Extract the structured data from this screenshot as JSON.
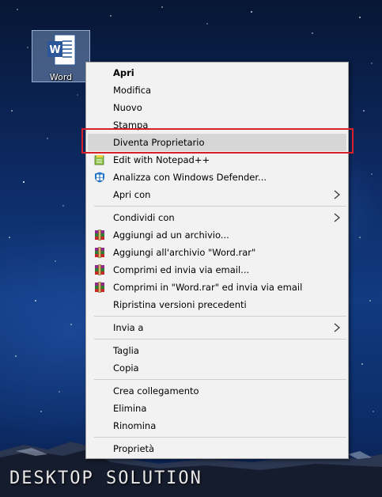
{
  "desktop_icon": {
    "label": "Word",
    "icon": "word-document-icon"
  },
  "context_menu": {
    "items": [
      {
        "label": "Apri",
        "bold": true
      },
      {
        "label": "Modifica"
      },
      {
        "label": "Nuovo"
      },
      {
        "label": "Stampa"
      },
      {
        "label": "Diventa Proprietario",
        "highlighted": true
      },
      {
        "label": "Edit with Notepad++",
        "icon": "notepad-plus-icon"
      },
      {
        "label": "Analizza con Windows Defender...",
        "icon": "windows-defender-icon"
      },
      {
        "label": "Apri con",
        "submenu": true
      },
      {
        "label": "Condividi con",
        "submenu": true
      },
      {
        "label": "Aggiungi ad un archivio...",
        "icon": "winrar-icon"
      },
      {
        "label": "Aggiungi all'archivio \"Word.rar\"",
        "icon": "winrar-icon"
      },
      {
        "label": "Comprimi ed invia via email...",
        "icon": "winrar-icon"
      },
      {
        "label": "Comprimi in \"Word.rar\" ed invia via email",
        "icon": "winrar-icon"
      },
      {
        "label": "Ripristina versioni precedenti"
      },
      {
        "label": "Invia a",
        "submenu": true
      },
      {
        "label": "Taglia"
      },
      {
        "label": "Copia"
      },
      {
        "label": "Crea collegamento"
      },
      {
        "label": "Elimina"
      },
      {
        "label": "Rinomina"
      },
      {
        "label": "Proprietà"
      }
    ]
  },
  "colors": {
    "highlight_border": "#d8202b",
    "menu_background": "#f2f2f2",
    "selected_item": "#d6d6d6"
  },
  "watermark": "DESKTOP SOLUTION"
}
